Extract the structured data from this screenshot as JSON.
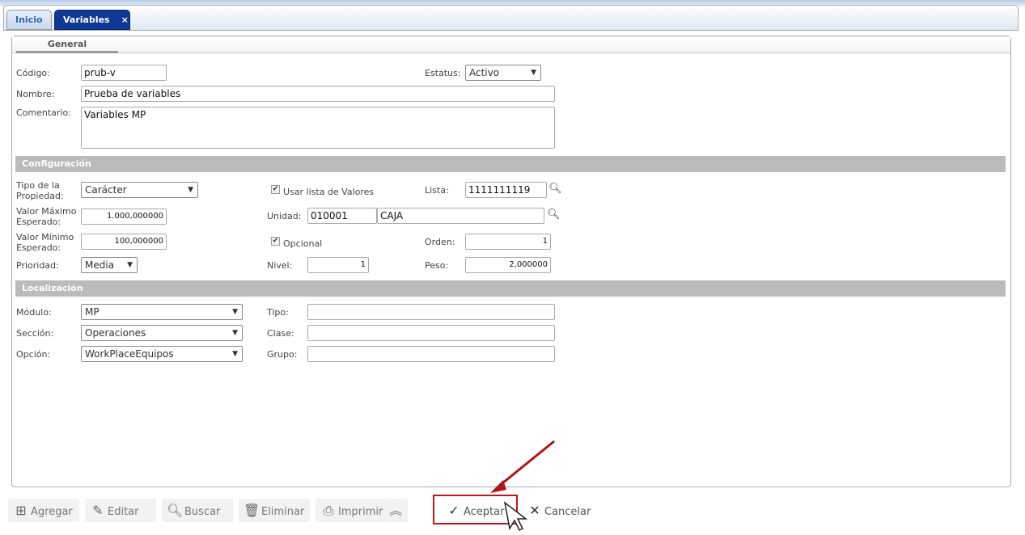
{
  "tabs": [
    {
      "label": "Inicio"
    },
    {
      "label": "Variables",
      "close": "×"
    }
  ],
  "subtab": "General",
  "general": {
    "codigo_label": "Código:",
    "codigo": "prub-v",
    "estatus_label": "Estatus:",
    "estatus": "Activo",
    "nombre_label": "Nombre:",
    "nombre": "Prueba de variables",
    "comentario_label": "Comentario:",
    "comentario": "Variables MP"
  },
  "config": {
    "title": "Configuración",
    "tipo_label1": "Tipo de la",
    "tipo_label2": "Propiedad:",
    "tipo": "Carácter",
    "usar_lista_label": "Usar lista de Valores",
    "usar_lista": true,
    "lista_label": "Lista:",
    "lista": "1111111119",
    "max_label1": "Valor Máximo",
    "max_label2": "Esperado:",
    "max": "1.000,000000",
    "unidad_label": "Unidad:",
    "unidad_code": "010001",
    "unidad_name": "CAJA",
    "min_label1": "Valor Mínimo",
    "min_label2": "Esperado:",
    "min": "100,000000",
    "opcional_label": "Opcional",
    "opcional": true,
    "orden_label": "Orden:",
    "orden": "1",
    "prioridad_label": "Prioridad:",
    "prioridad": "Media",
    "nivel_label": "Nivel:",
    "nivel": "1",
    "peso_label": "Peso:",
    "peso": "2,000000"
  },
  "loc": {
    "title": "Localización",
    "modulo_label": "Módulo:",
    "modulo": "MP",
    "tipo_label": "Tipo:",
    "tipo": "",
    "seccion_label": "Sección:",
    "seccion": "Operaciones",
    "clase_label": "Clase:",
    "clase": "",
    "opcion_label": "Opción:",
    "opcion": "WorkPlaceEquipos",
    "grupo_label": "Grupo:",
    "grupo": ""
  },
  "toolbar": {
    "agregar": "Agregar",
    "editar": "Editar",
    "buscar": "Buscar",
    "eliminar": "Eliminar",
    "imprimir": "Imprimir",
    "aceptar": "Aceptar",
    "cancelar": "Cancelar"
  },
  "colors": {
    "tab_active": "#0f3895",
    "section": "#bbbbbb",
    "highlight": "#c0171c"
  }
}
